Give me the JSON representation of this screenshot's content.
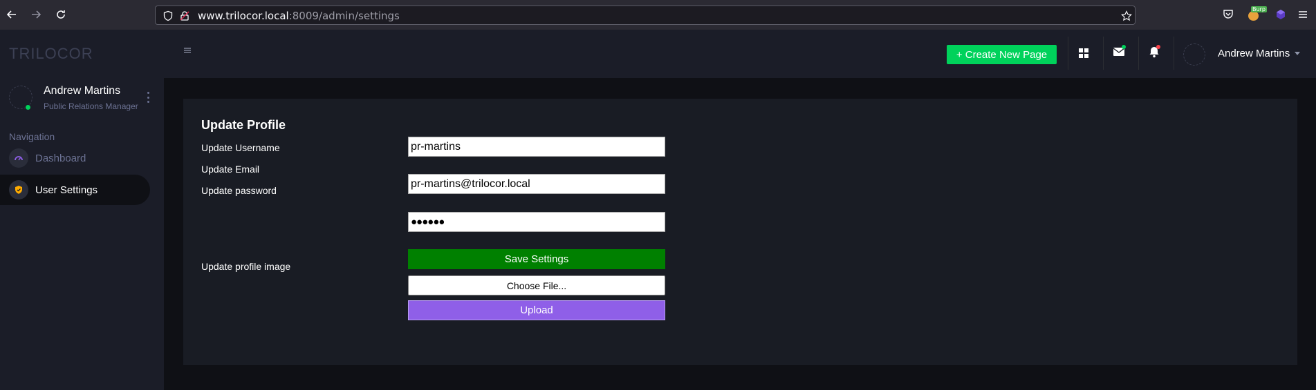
{
  "browser": {
    "url_host": "www.trilocor.local",
    "url_rest": ":8009/admin/settings",
    "burp_badge": "Burp"
  },
  "sidebar": {
    "brand": "TRILOCOR",
    "profile_name": "Andrew Martins",
    "profile_role": "Public Relations Manager",
    "nav_heading": "Navigation",
    "items": [
      {
        "label": "Dashboard",
        "active": false
      },
      {
        "label": "User Settings",
        "active": true
      }
    ]
  },
  "topbar": {
    "create_label": "+ Create New Page",
    "user_name": "Andrew Martins"
  },
  "form": {
    "title": "Update Profile",
    "username_label": "Update Username",
    "email_label": "Update Email",
    "password_label": "Update password",
    "image_label": "Update profile image",
    "username_value": "pr-martins",
    "email_value": "pr-martins@trilocor.local",
    "password_value": "●●●●●●",
    "save_label": "Save Settings",
    "choose_file_label": "Choose File...",
    "upload_label": "Upload"
  },
  "colors": {
    "accent_green": "#00d25b",
    "save_green": "#008000",
    "upload_purple": "#8f5fe8",
    "sidebar_bg": "#1b1d28",
    "card_bg": "#191c24"
  }
}
